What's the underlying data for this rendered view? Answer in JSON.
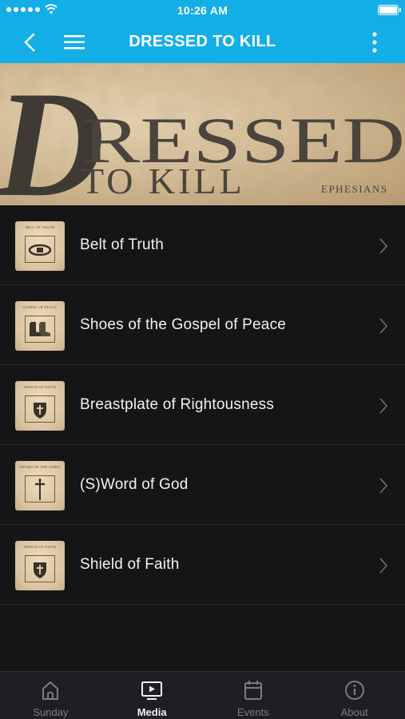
{
  "status_bar": {
    "time": "10:26 AM"
  },
  "header": {
    "title": "DRESSED TO KILL"
  },
  "banner": {
    "big_text": "RESSED",
    "initial": "D",
    "subtitle": "TO KILL",
    "tag": "EPHESIANS"
  },
  "items": [
    {
      "label": "Belt of Truth",
      "thumb_caption": "BELT OF TRUTH",
      "icon": "belt-icon"
    },
    {
      "label": "Shoes of the Gospel of Peace",
      "thumb_caption": "GOSPEL OF PEACE",
      "icon": "shoes-icon"
    },
    {
      "label": "Breastplate of Rightousness",
      "thumb_caption": "SHIELD OF FAITH",
      "icon": "breastplate-icon"
    },
    {
      "label": "(S)Word of God",
      "thumb_caption": "SWORD OF THE SPIRIT",
      "icon": "sword-icon"
    },
    {
      "label": "Shield of Faith",
      "thumb_caption": "SHIELD OF FAITH",
      "icon": "shield-icon"
    }
  ],
  "tabs": [
    {
      "label": "Sunday",
      "icon": "church-icon",
      "active": false
    },
    {
      "label": "Media",
      "icon": "media-icon",
      "active": true
    },
    {
      "label": "Events",
      "icon": "calendar-icon",
      "active": false
    },
    {
      "label": "About",
      "icon": "info-icon",
      "active": false
    }
  ],
  "colors": {
    "accent": "#14aee6",
    "background": "#141517",
    "tabbar": "#1e1f22"
  }
}
